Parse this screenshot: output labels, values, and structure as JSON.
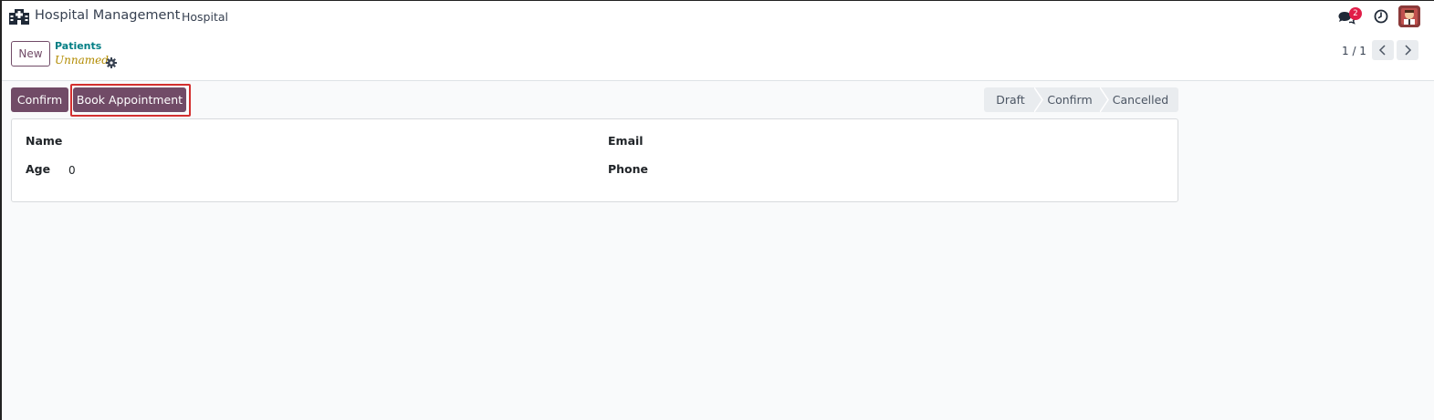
{
  "navbar": {
    "app_icon": "hospital-icon",
    "app_name": "Hospital Management",
    "menu": [
      "Hospital"
    ],
    "messages_badge": "2",
    "icons": [
      "chat-icon",
      "clock-icon",
      "avatar"
    ]
  },
  "control_panel": {
    "new_button": "New",
    "breadcrumb": "Patients",
    "record_name": "Unnamed",
    "pager_value": "1 / 1"
  },
  "actions": {
    "confirm_button": "Confirm",
    "book_appointment_button": "Book Appointment"
  },
  "statusbar": {
    "steps": [
      "Draft",
      "Confirm",
      "Cancelled"
    ]
  },
  "form": {
    "name_label": "Name",
    "name_value": "",
    "age_label": "Age",
    "age_value": "0",
    "email_label": "Email",
    "email_value": "",
    "phone_label": "Phone",
    "phone_value": ""
  },
  "colors": {
    "brand": "#714B67",
    "link": "#017e84",
    "unsaved": "#b28b00",
    "badge": "#e11d48",
    "highlight": "#d32f2f"
  }
}
